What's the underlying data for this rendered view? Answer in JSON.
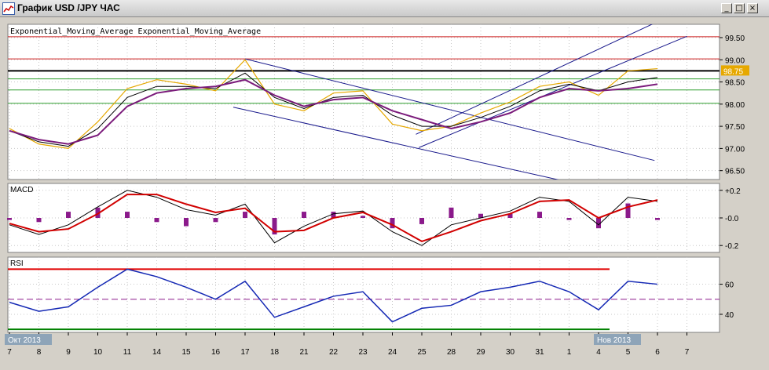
{
  "window": {
    "title": "График USD /JPY ЧАС",
    "buttons": {
      "minimize": "_",
      "maximize": "□",
      "close": "×"
    }
  },
  "colors": {
    "background": "#ffffff",
    "grid": "#c8c8c8",
    "price": "#e6a800",
    "ema_fast": "#000000",
    "ema_slow": "#7b1b7b",
    "channel": "#1a1a8c",
    "resistance": "#cc1f1f",
    "support": "#2e9e2e",
    "current_level": "#000000",
    "macd_line": "#000000",
    "signal_line": "#d10000",
    "histogram": "#8b1a8b",
    "rsi": "#1428b4",
    "rsi_upper": "#e00000",
    "rsi_lower": "#008000",
    "rsi_mid": "#8b1a8b"
  },
  "main_panel": {
    "indicator_label": "Exponential_Moving_Average Exponential_Moving_Average",
    "current_price_label": "98.75"
  },
  "macd_panel": {
    "label": "MACD"
  },
  "rsi_panel": {
    "label": "RSI"
  },
  "x_axis": {
    "month_labels": [
      {
        "text": "Окт 2013",
        "index": 0
      },
      {
        "text": "Нов 2013",
        "index": 20
      }
    ]
  },
  "chart_data": [
    {
      "type": "line",
      "title": "",
      "x": [
        "7",
        "8",
        "9",
        "10",
        "11",
        "14",
        "15",
        "16",
        "17",
        "18",
        "21",
        "22",
        "23",
        "24",
        "25",
        "28",
        "29",
        "30",
        "31",
        "1",
        "4",
        "5",
        "6",
        "7"
      ],
      "ylim": [
        96.3,
        99.8
      ],
      "yticks": [
        "96.50",
        "97.00",
        "97.50",
        "98.00",
        "98.50",
        "99.00",
        "99.50"
      ],
      "grid": true,
      "horizontal_levels": {
        "resistance": [
          99.52,
          99.02
        ],
        "support": [
          98.57,
          98.32,
          98.02
        ],
        "current": 98.75
      },
      "trend_lines": [
        {
          "name": "down-upper",
          "from": [
            8.0,
            99.02
          ],
          "to": [
            21.9,
            96.73
          ]
        },
        {
          "name": "down-lower",
          "from": [
            7.6,
            97.93
          ],
          "to": [
            18.8,
            96.27
          ]
        },
        {
          "name": "up-upper",
          "from": [
            13.8,
            97.32
          ],
          "to": [
            22.2,
            99.92
          ]
        },
        {
          "name": "up-lower",
          "from": [
            13.9,
            97.02
          ],
          "to": [
            23.0,
            99.53
          ]
        }
      ],
      "series": [
        {
          "name": "",
          "role": "price",
          "values": [
            97.45,
            97.1,
            97.0,
            97.6,
            98.35,
            98.55,
            98.45,
            98.3,
            99.0,
            98.0,
            97.85,
            98.25,
            98.3,
            97.55,
            97.4,
            97.5,
            97.8,
            98.05,
            98.4,
            98.5,
            98.2,
            98.75,
            98.8
          ]
        },
        {
          "name": "Exponential_Moving_Average",
          "role": "ema_fast",
          "values": [
            97.4,
            97.15,
            97.05,
            97.45,
            98.15,
            98.4,
            98.4,
            98.35,
            98.7,
            98.15,
            97.9,
            98.15,
            98.2,
            97.75,
            97.5,
            97.5,
            97.7,
            97.95,
            98.3,
            98.45,
            98.3,
            98.5,
            98.6
          ]
        },
        {
          "name": "Exponential_Moving_Average",
          "role": "ema_slow",
          "values": [
            97.4,
            97.2,
            97.1,
            97.3,
            97.95,
            98.25,
            98.35,
            98.4,
            98.55,
            98.2,
            97.95,
            98.1,
            98.15,
            97.85,
            97.65,
            97.45,
            97.6,
            97.8,
            98.15,
            98.35,
            98.3,
            98.35,
            98.45
          ]
        }
      ]
    },
    {
      "type": "line",
      "title": "MACD",
      "ylim": [
        -0.25,
        0.25
      ],
      "yticks": [
        "+0.2",
        "-0.0",
        "-0.2"
      ],
      "series": [
        {
          "name": "",
          "role": "macd",
          "values": [
            -0.05,
            -0.12,
            -0.05,
            0.08,
            0.2,
            0.15,
            0.06,
            0.02,
            0.1,
            -0.18,
            -0.06,
            0.03,
            0.05,
            -0.1,
            -0.2,
            -0.05,
            0.0,
            0.05,
            0.15,
            0.12,
            -0.05,
            0.15,
            0.12
          ]
        },
        {
          "name": "",
          "role": "signal",
          "values": [
            -0.04,
            -0.1,
            -0.08,
            0.03,
            0.17,
            0.17,
            0.1,
            0.04,
            0.07,
            -0.1,
            -0.09,
            0.0,
            0.04,
            -0.05,
            -0.17,
            -0.1,
            -0.02,
            0.03,
            0.12,
            0.13,
            0.0,
            0.08,
            0.13
          ]
        }
      ]
    },
    {
      "type": "line",
      "title": "RSI",
      "ylim": [
        28,
        78
      ],
      "yticks": [
        "60",
        "40"
      ],
      "levels": {
        "upper": 70,
        "middle": 50,
        "lower": 30
      },
      "series": [
        {
          "name": "",
          "role": "rsi",
          "values": [
            48,
            42,
            45,
            58,
            70,
            65,
            58,
            50,
            62,
            38,
            45,
            52,
            55,
            35,
            44,
            46,
            55,
            58,
            62,
            55,
            43,
            62,
            60
          ]
        }
      ]
    }
  ]
}
